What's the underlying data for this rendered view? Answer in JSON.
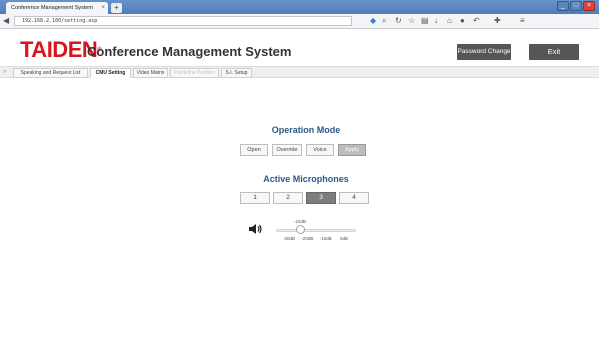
{
  "browser": {
    "tab_title": "Conference Management System",
    "new_tab": "+",
    "url": "192.168.2.100/setting.asp",
    "window_buttons": [
      "_",
      "□",
      "×"
    ]
  },
  "header": {
    "brand": "TAIDEN",
    "brand_mark": "®",
    "app_title": "Conference Management System",
    "password_change_label": "Password Change",
    "exit_label": "Exit",
    "brand_color": "#d7161f"
  },
  "nav": {
    "collapse_glyph": "»",
    "tabs": [
      {
        "label": "Speaking and Request List",
        "state": "normal"
      },
      {
        "label": "CMU Setting",
        "state": "active"
      },
      {
        "label": "Video Matrix",
        "state": "normal"
      },
      {
        "label": "Predefine Position",
        "state": "disabled"
      },
      {
        "label": "S.I. Setup",
        "state": "normal"
      }
    ]
  },
  "operation_mode": {
    "title": "Operation Mode",
    "buttons": [
      "Open",
      "Override",
      "Voice",
      "Apply"
    ],
    "highlighted": "Apply"
  },
  "active_microphones": {
    "title": "Active Microphones",
    "options": [
      "1",
      "2",
      "3",
      "4"
    ],
    "selected": "3"
  },
  "volume": {
    "icon": "speaker-icon",
    "current_label": "-24dB",
    "current_value_db": -24,
    "min_db": -30,
    "max_db": 0,
    "ticks": [
      "-30dB",
      "-20dB",
      "-10dB",
      "0dB"
    ]
  },
  "colors": {
    "section_title": "#2c5a85",
    "selected_mic": "#7d7d7d",
    "header_button": "#555555"
  }
}
